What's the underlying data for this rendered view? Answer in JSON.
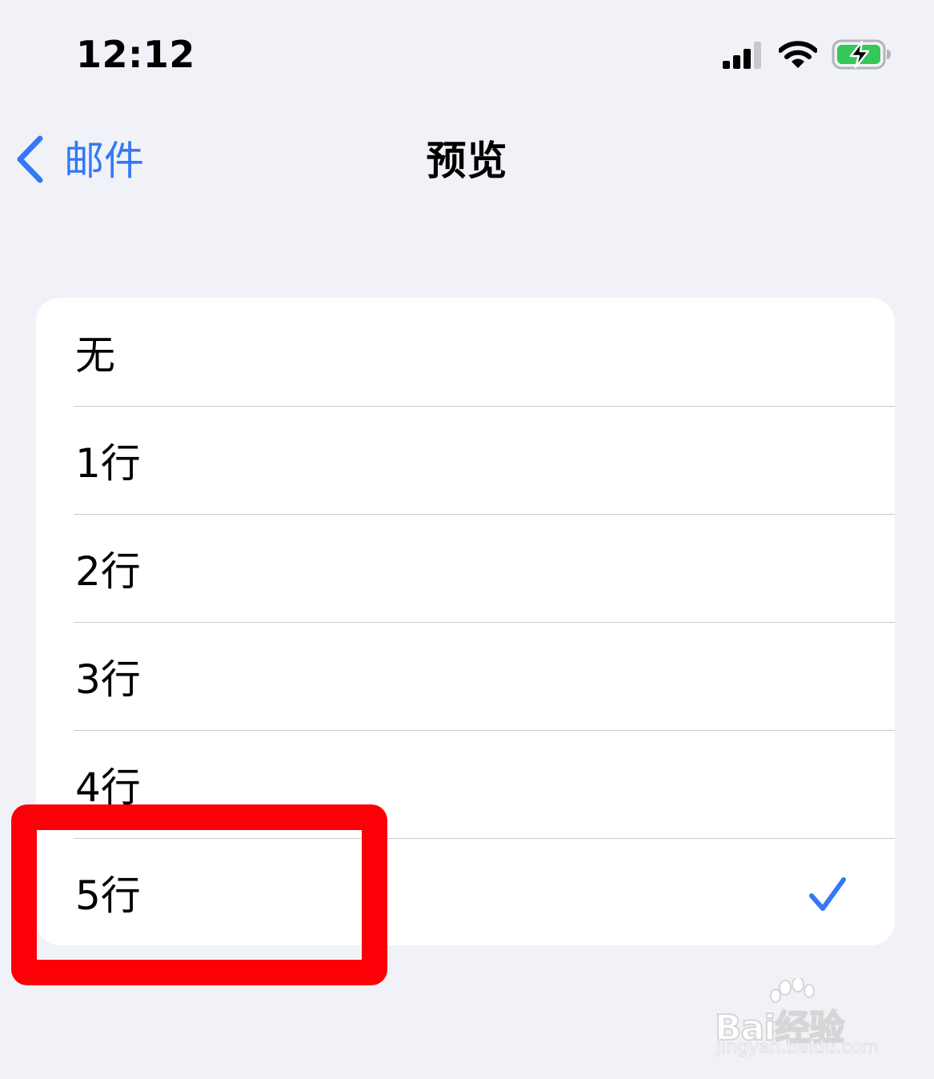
{
  "status_bar": {
    "time": "12:12",
    "icons": [
      "cellular-signal-icon",
      "wifi-icon",
      "battery-charging-icon"
    ],
    "battery_color": "#34c759"
  },
  "nav": {
    "back_label": "邮件",
    "title": "预览",
    "accent_color": "#3478f6"
  },
  "options": [
    {
      "label": "无",
      "selected": false
    },
    {
      "label": "1行",
      "selected": false
    },
    {
      "label": "2行",
      "selected": false
    },
    {
      "label": "3行",
      "selected": false
    },
    {
      "label": "4行",
      "selected": false
    },
    {
      "label": "5行",
      "selected": true
    }
  ],
  "annotation": {
    "color": "#fb0007"
  },
  "watermark": {
    "line1": "Bai经验",
    "line2": "jingyan.baidu.com"
  }
}
